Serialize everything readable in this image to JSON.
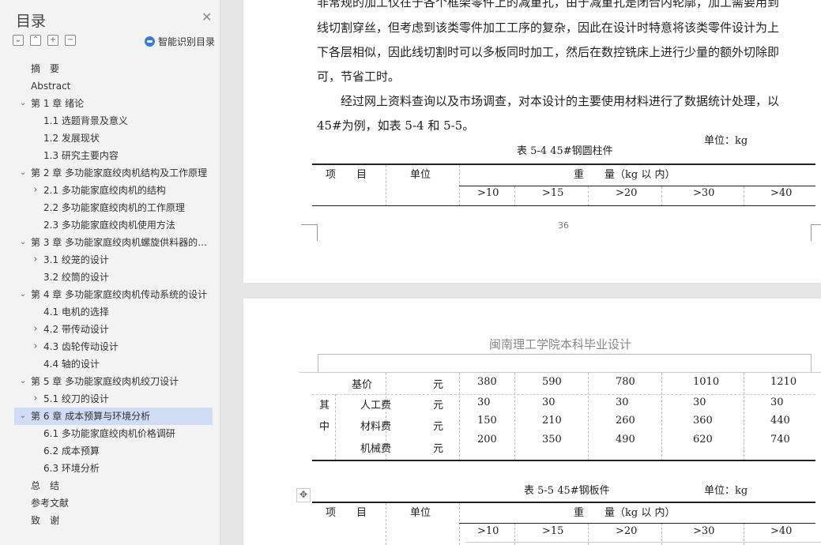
{
  "sidebar": {
    "title": "目录",
    "close_icon": "close-icon",
    "smart_toc_label": "智能识别目录",
    "toc": [
      {
        "label": "摘　要",
        "level": 1,
        "chevron": ""
      },
      {
        "label": "Abstract",
        "level": 1,
        "chevron": ""
      },
      {
        "label": "第 1 章  绪论",
        "level": 1,
        "chevron": "down"
      },
      {
        "label": "1.1 选题背景及意义",
        "level": 2,
        "chevron": ""
      },
      {
        "label": "1.2 发展现状",
        "level": 2,
        "chevron": ""
      },
      {
        "label": "1.3 研究主要内容",
        "level": 2,
        "chevron": ""
      },
      {
        "label": "第 2 章  多功能家庭绞肉机结构及工作原理",
        "level": 1,
        "chevron": "down"
      },
      {
        "label": "2.1 多功能家庭绞肉机的结构",
        "level": 2,
        "chevron": "right"
      },
      {
        "label": "2.2 多功能家庭绞肉机的工作原理",
        "level": 2,
        "chevron": ""
      },
      {
        "label": "2.3 多功能家庭绞肉机使用方法",
        "level": 2,
        "chevron": ""
      },
      {
        "label": "第 3 章  多功能家庭绞肉机螺旋供料器的设计",
        "level": 1,
        "chevron": "down"
      },
      {
        "label": "3.1 绞笼的设计",
        "level": 2,
        "chevron": "right"
      },
      {
        "label": "3.2 绞筒的设计",
        "level": 2,
        "chevron": ""
      },
      {
        "label": "第 4 章  多功能家庭绞肉机传动系统的设计",
        "level": 1,
        "chevron": "down"
      },
      {
        "label": "4.1 电机的选择",
        "level": 2,
        "chevron": ""
      },
      {
        "label": "4.2 带传动设计",
        "level": 2,
        "chevron": "right"
      },
      {
        "label": "4.3 齿轮传动设计",
        "level": 2,
        "chevron": "right"
      },
      {
        "label": "4.4 轴的设计",
        "level": 2,
        "chevron": ""
      },
      {
        "label": "第 5 章  多功能家庭绞肉机绞刀设计",
        "level": 1,
        "chevron": "down"
      },
      {
        "label": "5.1 绞刀的设计",
        "level": 2,
        "chevron": "right"
      },
      {
        "label": "第 6 章  成本预算与环境分析",
        "level": 1,
        "chevron": "down",
        "selected": true
      },
      {
        "label": "6.1  多功能家庭绞肉机价格调研",
        "level": 2,
        "chevron": ""
      },
      {
        "label": "6.2  成本预算",
        "level": 2,
        "chevron": ""
      },
      {
        "label": "6.3  环境分析",
        "level": 2,
        "chevron": ""
      },
      {
        "label": "总　结",
        "level": 1,
        "chevron": ""
      },
      {
        "label": "参考文献",
        "level": 1,
        "chevron": ""
      },
      {
        "label": "致　谢",
        "level": 1,
        "chevron": ""
      }
    ]
  },
  "document": {
    "page1": {
      "lines": [
        "非常规的加工仅在于各个框架零件上的减重孔，由于减重孔是闭合内轮廓，加工需要用到",
        "线切割穿丝，但考虑到该类零件加工工序的复杂，因此在设计时特意将该类零件设计为上",
        "下各层相似，因此线切割时可以多板同时加工，然后在数控铣床上进行少量的额外切除即",
        "可，节省工时。",
        "　　经过网上资料查询以及市场调查，对本设计的主要使用材料进行了数据统计处理，以",
        "45#为例，如表 5-4 和 5-5。"
      ],
      "table_caption": "表 5-4 45#钢圆柱件",
      "unit_label": "单位：kg",
      "page_number": "36"
    },
    "page2": {
      "header_title": "闽南理工学院本科毕业设计",
      "table_caption": "表 5-5 45#钢板件",
      "unit_label": "单位：kg"
    },
    "table_header": {
      "col1": "项　　目",
      "col2": "单位",
      "weight_title": "重　　量（kg 以 内）",
      "ranges": [
        ">10",
        ">15",
        ">20",
        ">30",
        ">40"
      ]
    },
    "table_54_body": {
      "base_label": "基价",
      "base_unit": "元",
      "base_values": [
        "380",
        "590",
        "780",
        "1010",
        "1210"
      ],
      "group_label_1": "其",
      "group_label_2": "中",
      "rows": [
        {
          "label": "人工费",
          "unit": "元",
          "values": [
            "30",
            "30",
            "30",
            "30",
            "30"
          ]
        },
        {
          "label": "材料费",
          "unit": "元",
          "values": [
            "150",
            "210",
            "260",
            "360",
            "440"
          ]
        },
        {
          "label": "机械费",
          "unit": "元",
          "values": [
            "200",
            "350",
            "490",
            "620",
            "740"
          ]
        }
      ]
    }
  }
}
